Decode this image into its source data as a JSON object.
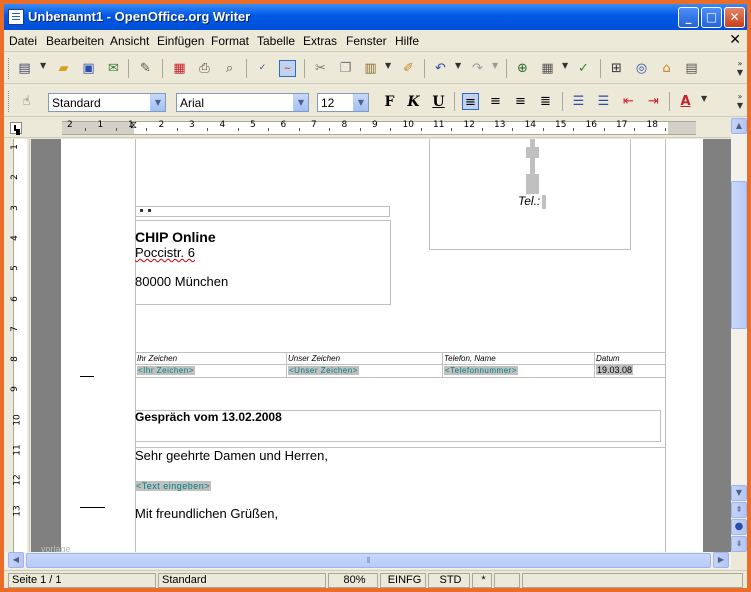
{
  "window": {
    "title": "Unbenannt1 - OpenOffice.org Writer"
  },
  "menubar": {
    "items": [
      "Datei",
      "Bearbeiten",
      "Ansicht",
      "Einfügen",
      "Format",
      "Tabelle",
      "Extras",
      "Fenster",
      "Hilfe"
    ],
    "close": "✕"
  },
  "formatting": {
    "paragraph_style": "Standard",
    "font_name": "Arial",
    "font_size": "12",
    "bold": "F",
    "italic": "K",
    "underline": "U"
  },
  "ruler": {
    "numbers": [
      "2",
      "1",
      "1",
      "2",
      "3",
      "4",
      "5",
      "6",
      "7",
      "8",
      "9",
      "10",
      "11",
      "12",
      "13",
      "14",
      "15",
      "16",
      "17",
      "18"
    ]
  },
  "vruler": {
    "numbers": [
      "1",
      "2",
      "3",
      "4",
      "5",
      "6",
      "7",
      "8",
      "9",
      "10",
      "11",
      "12",
      "13"
    ]
  },
  "document": {
    "phone_label": "Tel.:",
    "recipient_name": "CHIP Online",
    "recipient_street": "Poccistr. 6",
    "recipient_city": "80000 München",
    "ref_headers": [
      "Ihr Zeichen",
      "Unser Zeichen",
      "Telefon, Name",
      "Datum"
    ],
    "ref_values": [
      "<Ihr Zeichen>",
      "<Unser Zeichen>",
      "<Telefonnummer>",
      "19.03.08"
    ],
    "subject": "Gespräch vom 13.02.2008",
    "salutation": "Sehr geehrte Damen und Herren,",
    "body_placeholder": "<Text eingeben>",
    "closing": "Mit freundlichen Grüßen,",
    "footer_mark": "vorlage"
  },
  "statusbar": {
    "page": "Seite 1 / 1",
    "style": "Standard",
    "zoom": "80%",
    "insert_mode": "EINFG",
    "selection_mode": "STD",
    "modified": "*"
  }
}
